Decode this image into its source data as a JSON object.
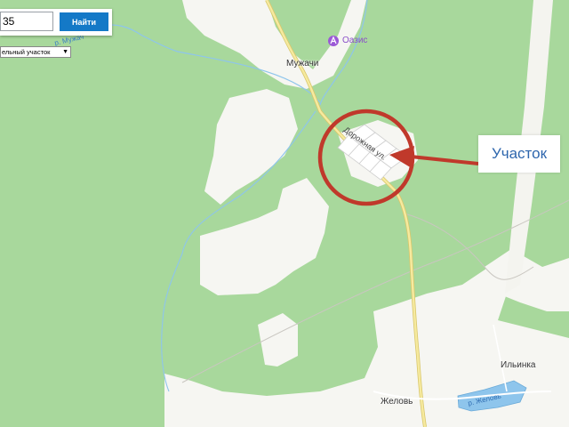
{
  "search": {
    "value": "35",
    "button_label": "Найти"
  },
  "filter": {
    "selected": "ельный участок"
  },
  "map": {
    "places": {
      "muzhachi": "Мужачи",
      "zhelov": "Желовь",
      "ilyinka": "Ильинка"
    },
    "poi": {
      "oasis": "Оазис"
    },
    "streets": {
      "dorozhnaya": "Дорожная ул."
    },
    "rivers": {
      "muzhach": "р. Мужач",
      "zhelov": "р. Желовь"
    },
    "annotation": {
      "label": "Участок",
      "color": "#c0392b"
    },
    "colors": {
      "forest": "#a8d89c",
      "open_land": "#f6f6f2",
      "road": "#f2e6a0",
      "water": "#8ec5ec"
    }
  }
}
